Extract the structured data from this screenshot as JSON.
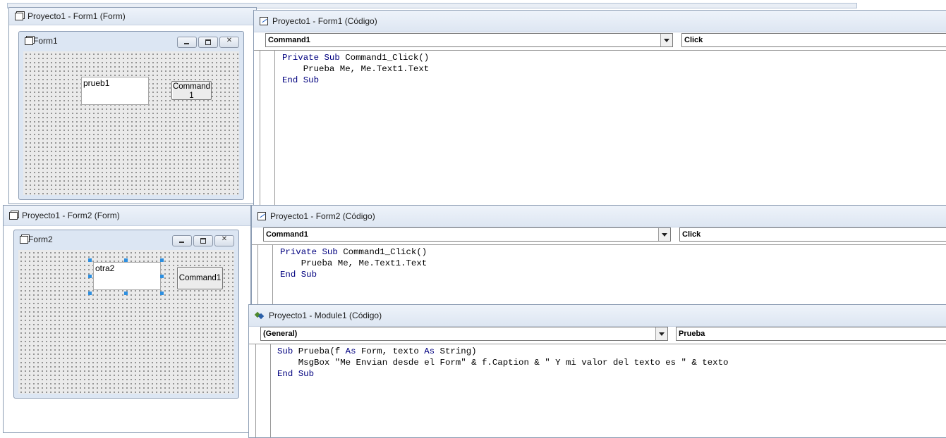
{
  "windows": {
    "form1_designer": {
      "title": "Proyecto1 - Form1 (Form)"
    },
    "form1_code": {
      "title": "Proyecto1 - Form1 (Código)",
      "object_combo": "Command1",
      "proc_combo": "Click"
    },
    "form2_designer": {
      "title": "Proyecto1 - Form2 (Form)"
    },
    "form2_code": {
      "title": "Proyecto1 - Form2 (Código)",
      "object_combo": "Command1",
      "proc_combo": "Click"
    },
    "module1_code": {
      "title": "Proyecto1 - Module1 (Código)",
      "object_combo": "(General)",
      "proc_combo": "Prueba"
    }
  },
  "forms": {
    "form1": {
      "caption": "Form1",
      "textbox_value": "prueb1",
      "button_line1": "Command",
      "button_line2": "1"
    },
    "form2": {
      "caption": "Form2",
      "textbox_value": "otra2",
      "button_label": "Command1"
    }
  },
  "code": {
    "form1": {
      "l1_kw": "Private Sub",
      "l1_rest": " Command1_Click()",
      "l2": "    Prueba Me, Me.Text1.Text",
      "l3_kw": "End Sub"
    },
    "form2": {
      "l1_kw": "Private Sub",
      "l1_rest": " Command1_Click()",
      "l2": "    Prueba Me, Me.Text1.Text",
      "l3_kw": "End Sub"
    },
    "module1": {
      "l1_kw": "Sub",
      "l1_a": " Prueba(f ",
      "l1_as1": "As",
      "l1_b": " Form, texto ",
      "l1_as2": "As",
      "l1_c": " String)",
      "l2": "    MsgBox \"Me Envian desde el Form\" & f.Caption & \" Y mi valor del texto es \" & texto",
      "l3_kw": "End Sub"
    }
  },
  "colors": {
    "keyword": "#00007f",
    "selection_handle": "#2d8fe0",
    "title_bar": "#dde6f2"
  }
}
